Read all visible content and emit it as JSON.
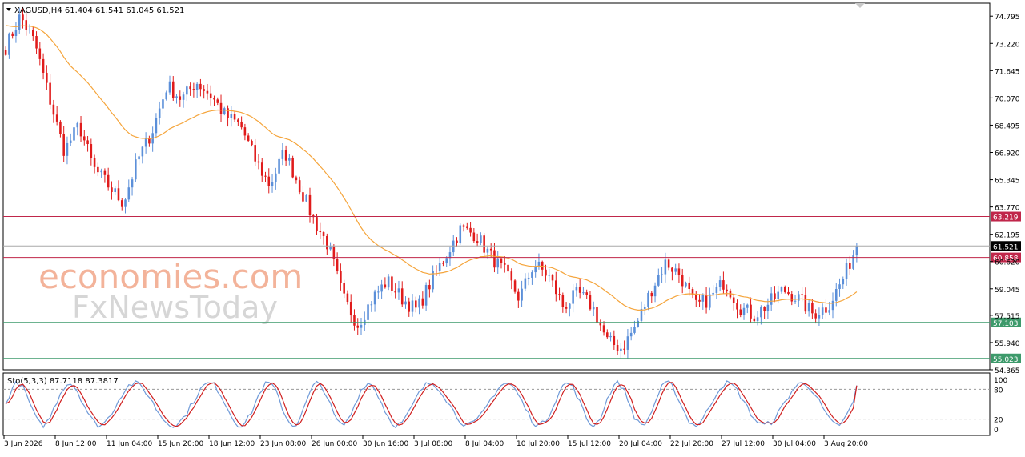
{
  "colors": {
    "background": "#ffffff",
    "frame": "#000000",
    "bull_candle": "#5b8fd9",
    "bear_candle": "#e01b1b",
    "moving_average": "#f5a53c",
    "resistance_line": "#c0264a",
    "support_line": "#3d9a6b",
    "current_price_line": "#a8a8a8",
    "current_price_tag": "#000000",
    "stoch_main": "#6f9ad8",
    "stoch_signal": "#d01f1f",
    "stoch_levels": "#9a9a9a",
    "watermark": "#f3b39a",
    "watermark2": "#d9d9d9"
  },
  "chart_data": [
    {
      "type": "candlestick",
      "title": "XAGUSD,H4  61.404 61.541 61.045 61.521",
      "ylim": [
        54.365,
        75.545
      ],
      "yticks": [
        74.795,
        73.22,
        71.645,
        70.07,
        68.495,
        66.92,
        65.345,
        63.77,
        62.195,
        60.62,
        59.045,
        57.515,
        55.94,
        54.365
      ],
      "ytick_labels": [
        "74.795",
        "73.220",
        "71.645",
        "70.070",
        "68.495",
        "66.920",
        "65.345",
        "63.770",
        "62.195",
        "60.620",
        "59.045",
        "57.515",
        "55.940",
        "54.365"
      ],
      "x_labels": [
        "3 Jun 2026",
        "8 Jun 12:00",
        "11 Jun 04:00",
        "15 Jun 20:00",
        "18 Jun 12:00",
        "23 Jun 08:00",
        "26 Jun 00:00",
        "30 Jun 16:00",
        "3 Jul 08:00",
        "8 Jul 04:00",
        "10 Jul 20:00",
        "15 Jul 12:00",
        "20 Jul 04:00",
        "22 Jul 20:00",
        "27 Jul 12:00",
        "30 Jul 04:00",
        "3 Aug 20:00"
      ],
      "close_path": [
        73.0,
        74.8,
        73.2,
        70.0,
        67.0,
        68.5,
        66.0,
        65.0,
        64.0,
        66.5,
        68.2,
        70.8,
        70.0,
        71.0,
        70.2,
        69.0,
        68.5,
        66.5,
        65.0,
        67.0,
        65.0,
        63.0,
        61.5,
        58.5,
        57.0,
        58.5,
        59.5,
        58.5,
        57.8,
        59.5,
        61.0,
        62.5,
        62.2,
        61.0,
        60.0,
        58.5,
        60.5,
        59.8,
        58.0,
        58.8,
        58.0,
        56.0,
        55.6,
        57.0,
        59.0,
        60.6,
        59.8,
        58.0,
        58.5,
        59.5,
        58.0,
        57.5,
        58.2,
        59.0,
        58.5,
        57.6,
        58.0,
        59.5,
        61.521
      ],
      "levels": [
        {
          "label": "63.219",
          "value": 63.219,
          "role": "resistance"
        },
        {
          "label": "60.858",
          "value": 60.858,
          "role": "resistance"
        },
        {
          "label": "57.103",
          "value": 57.103,
          "role": "support"
        },
        {
          "label": "55.023",
          "value": 55.023,
          "role": "support"
        }
      ],
      "current_price": {
        "label": "61.521",
        "value": 61.521
      }
    },
    {
      "type": "line",
      "title": "Sto(5,3,3) 87.7118 87.3817",
      "ylim": [
        0,
        100
      ],
      "levels": [
        {
          "label": "100",
          "value": 100
        },
        {
          "label": "80",
          "value": 80
        },
        {
          "label": "20",
          "value": 20
        },
        {
          "label": "0",
          "value": 0
        }
      ],
      "last_values": {
        "main": 87.7118,
        "signal": 87.3817
      }
    }
  ],
  "watermark": {
    "line1": "economies.com",
    "line2": "FxNewsToday"
  }
}
